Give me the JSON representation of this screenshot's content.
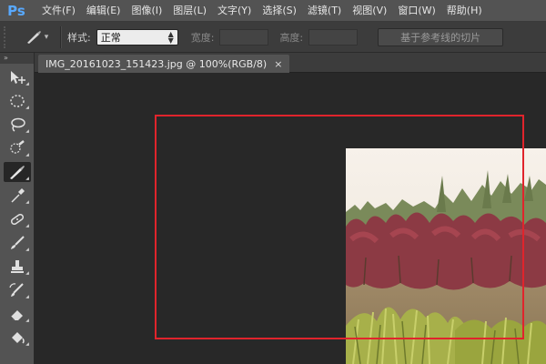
{
  "app": {
    "logo_text": "Ps"
  },
  "menu": [
    {
      "label": "文件(F)"
    },
    {
      "label": "编辑(E)"
    },
    {
      "label": "图像(I)"
    },
    {
      "label": "图层(L)"
    },
    {
      "label": "文字(Y)"
    },
    {
      "label": "选择(S)"
    },
    {
      "label": "滤镜(T)"
    },
    {
      "label": "视图(V)"
    },
    {
      "label": "窗口(W)"
    },
    {
      "label": "帮助(H)"
    }
  ],
  "options": {
    "style_label": "样式:",
    "style_value": "正常",
    "width_label": "宽度:",
    "width_value": "",
    "height_label": "高度:",
    "height_value": "",
    "guides_button": "基于参考线的切片"
  },
  "toolbar": {
    "collapse": "»",
    "tools": [
      {
        "icon": "move-icon"
      },
      {
        "icon": "elliptical-marquee-icon"
      },
      {
        "icon": "lasso-icon"
      },
      {
        "icon": "quick-selection-icon"
      },
      {
        "icon": "slice-icon",
        "active": true
      },
      {
        "icon": "eyedropper-icon"
      },
      {
        "icon": "healing-brush-icon"
      },
      {
        "icon": "brush-icon"
      },
      {
        "icon": "clone-stamp-icon"
      },
      {
        "icon": "history-brush-icon"
      },
      {
        "icon": "eraser-icon"
      },
      {
        "icon": "paint-bucket-icon"
      }
    ]
  },
  "document": {
    "tab_title": "IMG_20161023_151423.jpg @ 100%(RGB/8)",
    "close_glyph": "×"
  },
  "colors": {
    "selection": "#e0242c",
    "logo": "#58a9ff",
    "canvas_bg": "#282828"
  }
}
